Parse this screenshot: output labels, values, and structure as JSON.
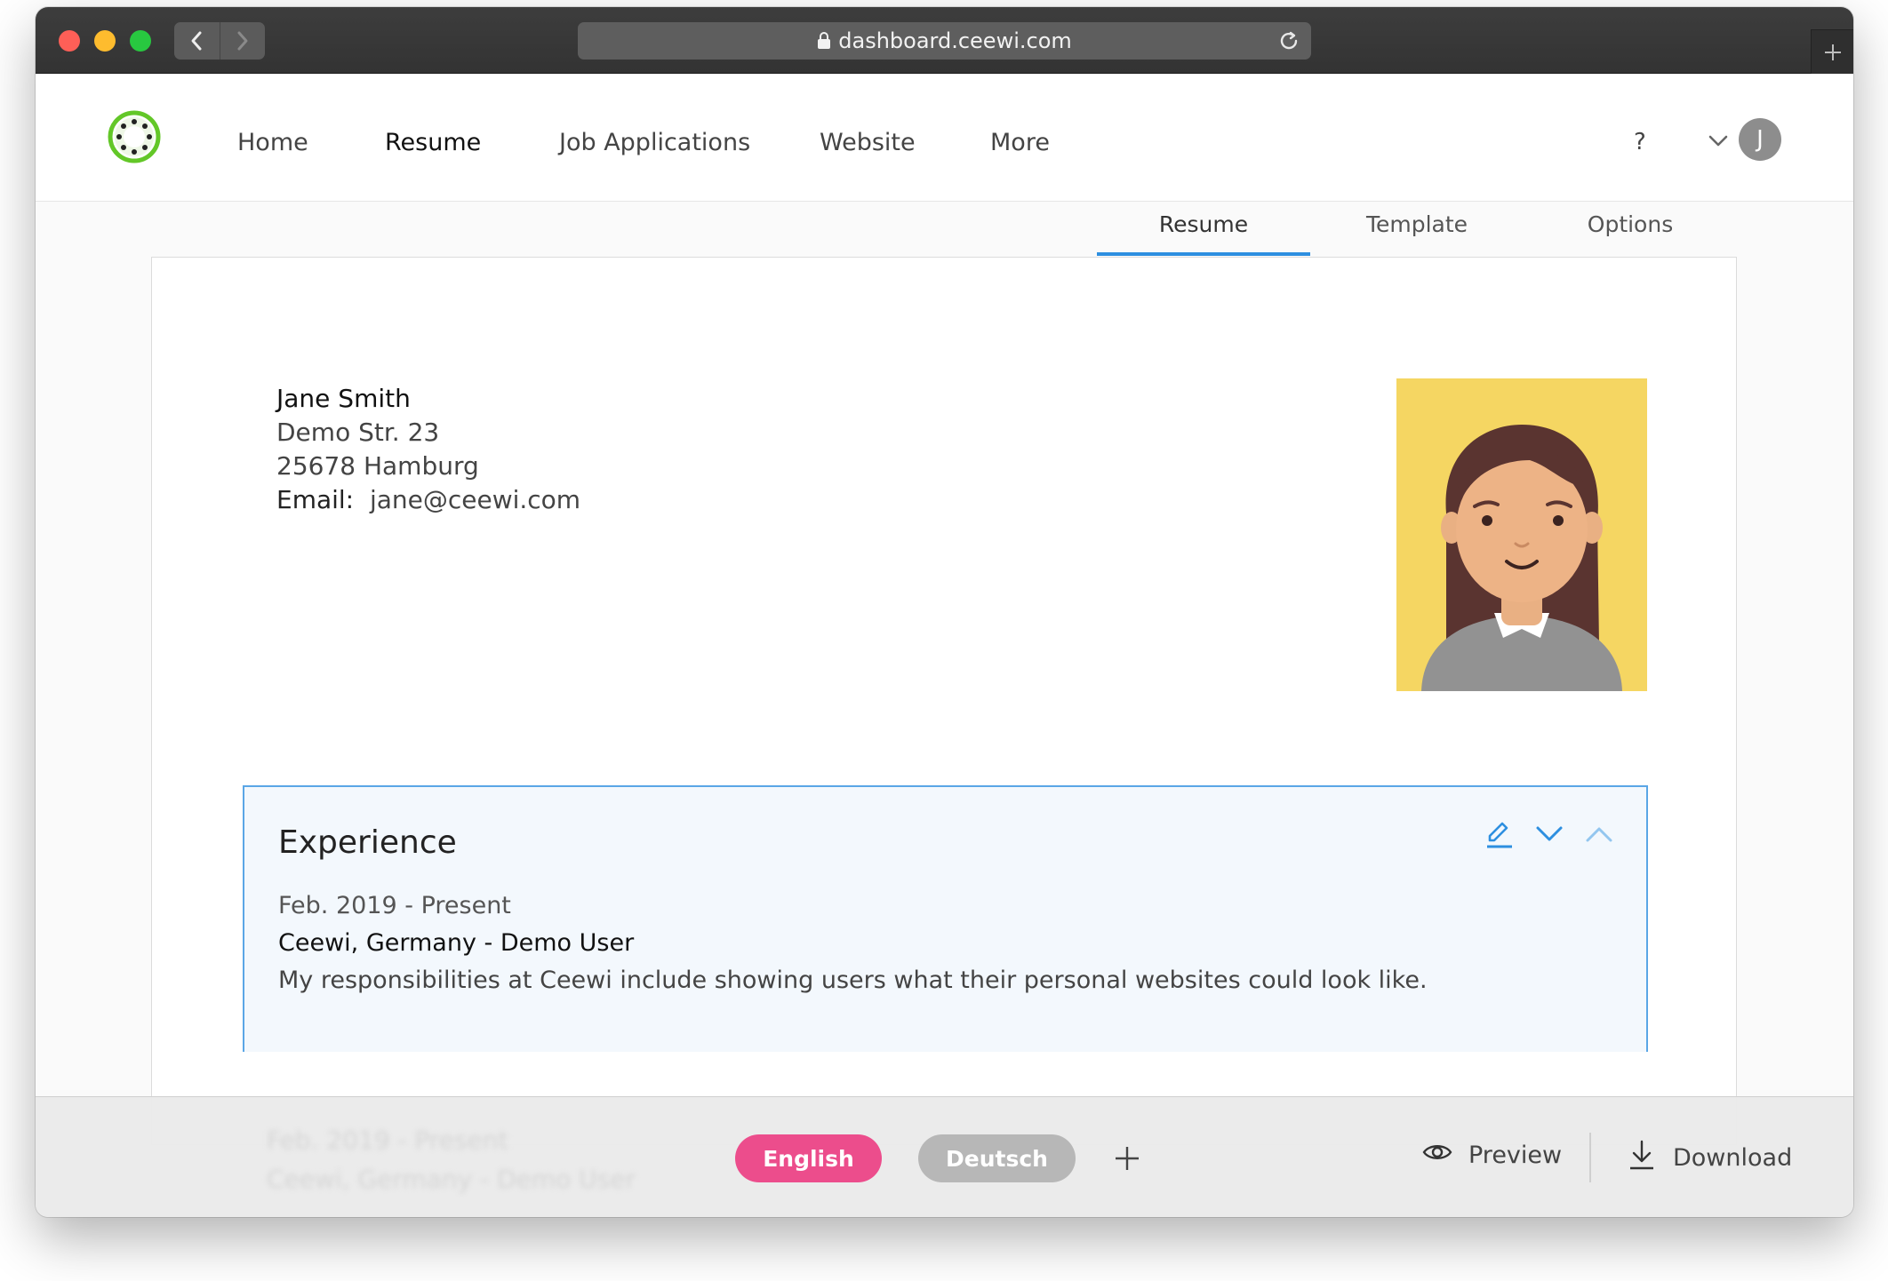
{
  "browser": {
    "url": "dashboard.ceewi.com"
  },
  "nav": {
    "items": [
      {
        "label": "Home"
      },
      {
        "label": "Resume"
      },
      {
        "label": "Job Applications"
      },
      {
        "label": "Website"
      },
      {
        "label": "More"
      }
    ],
    "help": "?",
    "user_initial": "J"
  },
  "subtabs": [
    {
      "label": "Resume",
      "active": true
    },
    {
      "label": "Template",
      "active": false
    },
    {
      "label": "Options",
      "active": false
    }
  ],
  "contact": {
    "name": "Jane Smith",
    "street": "Demo Str. 23",
    "city": "25678 Hamburg",
    "email_label": "Email:",
    "email": "jane@ceewi.com"
  },
  "experience": {
    "title": "Experience",
    "date_range": "Feb. 2019 - Present",
    "employer": "Ceewi, Germany - Demo User",
    "description": "My responsibilities at Ceewi include showing users what their personal websites could look like."
  },
  "bottombar": {
    "languages": [
      {
        "label": "English",
        "active": true
      },
      {
        "label": "Deutsch",
        "active": false
      }
    ],
    "preview_label": "Preview",
    "download_label": "Download"
  },
  "colors": {
    "brand_green": "#63c728",
    "accent_blue": "#2d8fe0",
    "language_active": "#ec4d8c",
    "language_inactive": "#b7b7b7",
    "photo_background": "#f5d662"
  },
  "icons": [
    "lock-icon",
    "reload-icon",
    "back-icon",
    "forward-icon",
    "new-tab-icon",
    "logo-icon",
    "chevron-down-icon",
    "edit-icon",
    "chevron-up-icon",
    "plus-icon",
    "eye-icon",
    "download-icon"
  ]
}
